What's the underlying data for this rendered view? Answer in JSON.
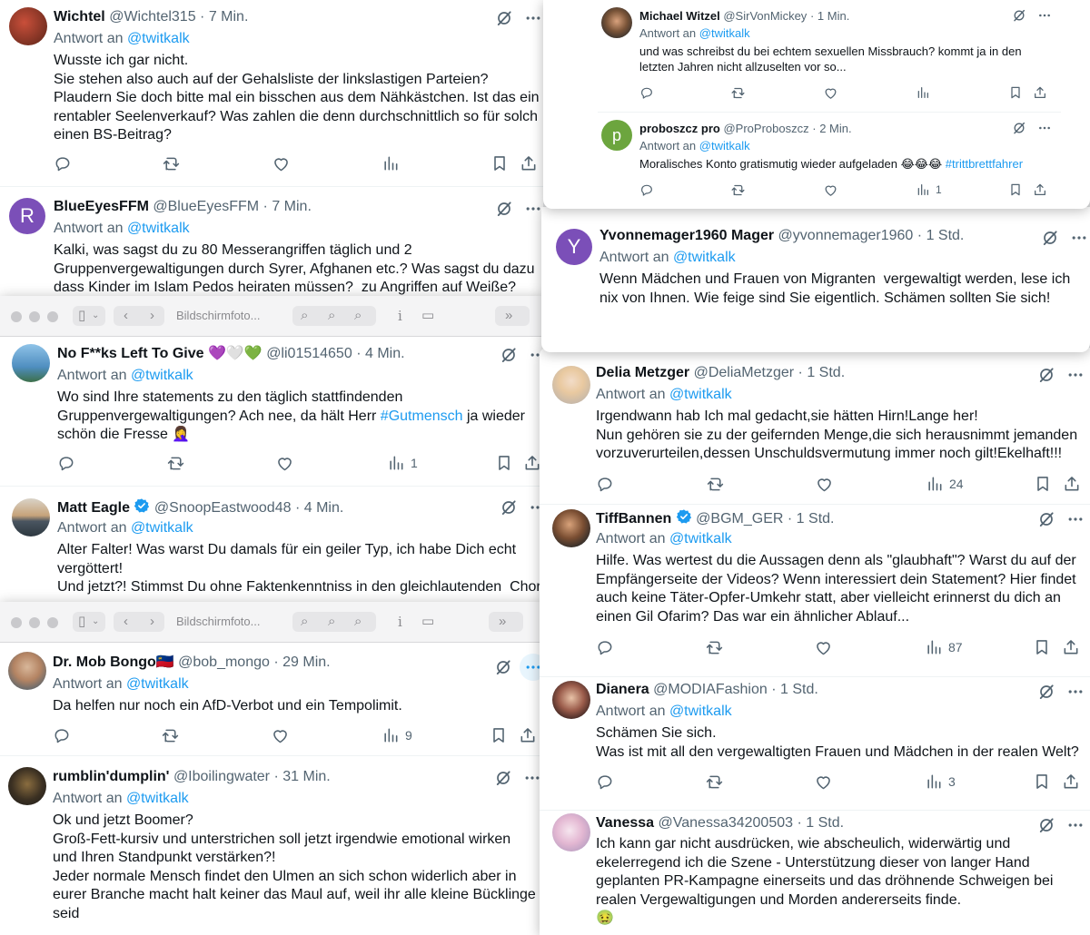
{
  "common": {
    "reply_prefix": "Antwort an ",
    "reply_target": "@twitkalk",
    "separator": "·"
  },
  "colors": {
    "link": "#1d9bf0",
    "text": "#0f1419",
    "muted": "#536471",
    "verified": "#1d9bf0"
  },
  "mini_toolbar": {
    "title": "Bildschirmfoto...",
    "icons": [
      "sidebar-icon",
      "chevron-down-icon",
      "back-icon",
      "forward-icon",
      "zoom-icon",
      "zoom-out-icon",
      "zoom-in-icon",
      "info-icon",
      "slideshow-icon",
      "double-chevron-icon"
    ]
  },
  "tweets": {
    "wichtel": {
      "name": "Wichtel",
      "handle": "@Wichtel315",
      "time": "7 Min.",
      "body": "Wusste ich gar nicht.\nSie stehen also auch auf der Gehalsliste der linkslastigen Parteien?\nPlaudern Sie doch bitte mal ein bisschen aus dem Nähkästchen. Ist das ein\nrentabler Seelenverkauf? Was zahlen die denn durchschnittlich so für solch\neinen BS-Beitrag?",
      "views": ""
    },
    "blueeyes": {
      "name": "BlueEyesFFM",
      "handle": "@BlueEyesFFM",
      "time": "7 Min.",
      "avatar_letter": "R",
      "body": "Kalki, was sagst du zu 80 Messerangriffen täglich und 2\nGruppenvergewaltigungen durch Syrer, Afghanen etc.? Was sagst du dazu\ndass Kinder im Islam Pedos heiraten müssen?  zu Angriffen auf Weiße?"
    },
    "nofucks": {
      "name": "No F**ks Left To Give",
      "name_emoji": "💜🤍💚",
      "handle": "@li01514650",
      "time": "4 Min.",
      "body_1": "Wo sind Ihre statements zu den täglich stattfindenden\nGruppenvergewaltigungen? Ach nee, da hält Herr ",
      "hashtag": "#Gutmensch",
      "body_2": " ja wieder\nschön die Fresse 🤦‍♀️",
      "views": "1"
    },
    "matteagle": {
      "name": "Matt Eagle",
      "handle": "@SnoopEastwood48",
      "time": "4 Min.",
      "body": "Alter Falter! Was warst Du damals für ein geiler Typ, ich habe Dich echt\nvergöttert!\nUnd jetzt?! Stimmst Du ohne Faktenkenntniss in den gleichlautenden  Chor"
    },
    "mobbongo": {
      "name": "Dr. Mob Bongo",
      "name_emoji": "🇱🇮",
      "handle": "@bob_mongo",
      "time": "29 Min.",
      "body": "Da helfen nur noch ein AfD-Verbot und ein Tempolimit.",
      "views": "9"
    },
    "rumblin": {
      "name": "rumblin'dumplin'",
      "handle": "@Iboilingwater",
      "time": "31 Min.",
      "body": "Ok und jetzt Boomer?\nGroß-Fett-kursiv und unterstrichen soll jetzt irgendwie emotional wirken\nund Ihren Standpunkt verstärken?!\nJeder normale Mensch findet den Ulmen an sich schon widerlich aber in\neurer Branche macht halt keiner das Maul auf, weil ihr alle kleine Bücklinge\nseid"
    },
    "witzel": {
      "name": "Michael Witzel",
      "handle": "@SirVonMickey",
      "time": "1 Min.",
      "body": "und was schreibst du bei echtem sexuellen Missbrauch? kommt ja in den\nletzten Jahren nicht allzuselten vor so..."
    },
    "proboszcz": {
      "name": "proboszcz pro",
      "handle": "@ProProboszcz",
      "time": "2 Min.",
      "avatar_letter": "p",
      "body_1": "Moralisches Konto gratismutig wieder aufgeladen 😂😂😂 ",
      "hashtag": "#trittbrettfahrer",
      "views": "1"
    },
    "yvonne": {
      "name": "Yvonnemager1960 Mager",
      "handle": "@yvonnemager1960",
      "time": "1 Std.",
      "avatar_letter": "Y",
      "body": "Wenn Mädchen und Frauen von Migranten  vergewaltigt werden, lese ich\nnix von Ihnen. Wie feige sind Sie eigentlich. Schämen sollten Sie sich!"
    },
    "delia": {
      "name": "Delia Metzger",
      "handle": "@DeliaMetzger",
      "time": "1 Std.",
      "body": "Irgendwann hab Ich mal gedacht,sie hätten Hirn!Lange her!\nNun gehören sie zu der geifernden Menge,die sich herausnimmt jemanden\nvorzuverurteilen,dessen Unschuldsvermutung immer noch gilt!Ekelhaft!!!",
      "views": "24"
    },
    "tiff": {
      "name": "TiffBannen",
      "handle": "@BGM_GER",
      "time": "1 Std.",
      "body": "Hilfe. Was wertest du die Aussagen denn als \"glaubhaft\"? Warst du auf der\nEmpfängerseite der Videos? Wenn interessiert dein Statement? Hier findet\nauch keine Täter-Opfer-Umkehr statt, aber vielleicht erinnerst du dich an\neinen Gil Ofarim? Das war ein ähnlicher Ablauf...",
      "views": "87"
    },
    "dianera": {
      "name": "Dianera",
      "handle": "@MODIAFashion",
      "time": "1 Std.",
      "body": "Schämen Sie sich.\nWas ist mit all den vergewaltigten Frauen und Mädchen in der realen Welt?",
      "views": "3"
    },
    "vanessa": {
      "name": "Vanessa",
      "handle": "@Vanessa34200503",
      "time": "1 Std.",
      "body": "Ich kann gar nicht ausdrücken, wie abscheulich, widerwärtig und\nekelerregend ich die Szene - Unterstützung dieser von langer Hand\ngeplanten PR-Kampagne einerseits und das dröhnende Schweigen bei\nrealen Vergewaltigungen und Morden andererseits finde.\n🤢"
    }
  }
}
